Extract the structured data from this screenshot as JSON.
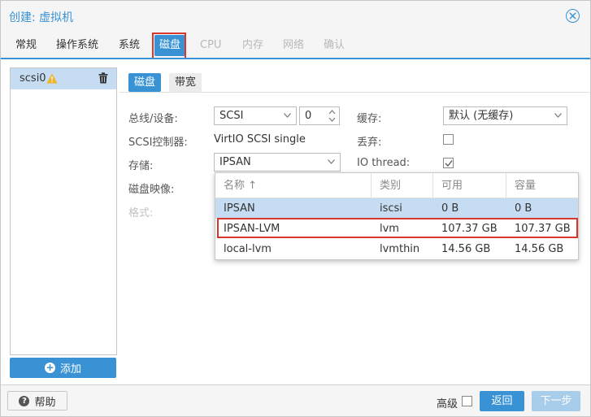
{
  "window": {
    "title": "创建: 虚拟机"
  },
  "tabs": [
    {
      "label": "常规",
      "state": "normal"
    },
    {
      "label": "操作系统",
      "state": "normal"
    },
    {
      "label": "系统",
      "state": "normal"
    },
    {
      "label": "磁盘",
      "state": "active"
    },
    {
      "label": "CPU",
      "state": "disabled"
    },
    {
      "label": "内存",
      "state": "disabled"
    },
    {
      "label": "网络",
      "state": "disabled"
    },
    {
      "label": "确认",
      "state": "disabled"
    }
  ],
  "disk_list": {
    "items": [
      {
        "label": "scsi0",
        "warning": true
      }
    ],
    "add_label": "添加"
  },
  "subtabs": [
    {
      "label": "磁盘"
    },
    {
      "label": "带宽"
    }
  ],
  "form": {
    "bus_label": "总线/设备:",
    "bus_value": "SCSI",
    "device_index": "0",
    "scsi_controller_label": "SCSI控制器:",
    "scsi_controller_value": "VirtIO SCSI single",
    "storage_label": "存储:",
    "storage_value": "IPSAN",
    "disk_image_label": "磁盘映像:",
    "format_label": "格式:",
    "cache_label": "缓存:",
    "cache_value": "默认 (无缓存)",
    "discard_label": "丢弃:",
    "discard_checked": false,
    "iothread_label": "IO thread:",
    "iothread_checked": true
  },
  "storage_dropdown": {
    "columns": [
      "名称 ↑",
      "类别",
      "可用",
      "容量"
    ],
    "rows": [
      {
        "name": "IPSAN",
        "type": "iscsi",
        "avail": "0 B",
        "capacity": "0 B",
        "selected": true
      },
      {
        "name": "IPSAN-LVM",
        "type": "lvm",
        "avail": "107.37 GB",
        "capacity": "107.37 GB",
        "selected": false
      },
      {
        "name": "local-lvm",
        "type": "lvmthin",
        "avail": "14.56 GB",
        "capacity": "14.56 GB",
        "selected": false
      }
    ]
  },
  "footer": {
    "help_label": "帮助",
    "advanced_label": "高级",
    "back_label": "返回",
    "next_label": "下一步"
  },
  "colors": {
    "accent": "#3892d4",
    "selection": "#c6dcf2",
    "highlight": "#d9372e",
    "warning": "#f0b323"
  }
}
